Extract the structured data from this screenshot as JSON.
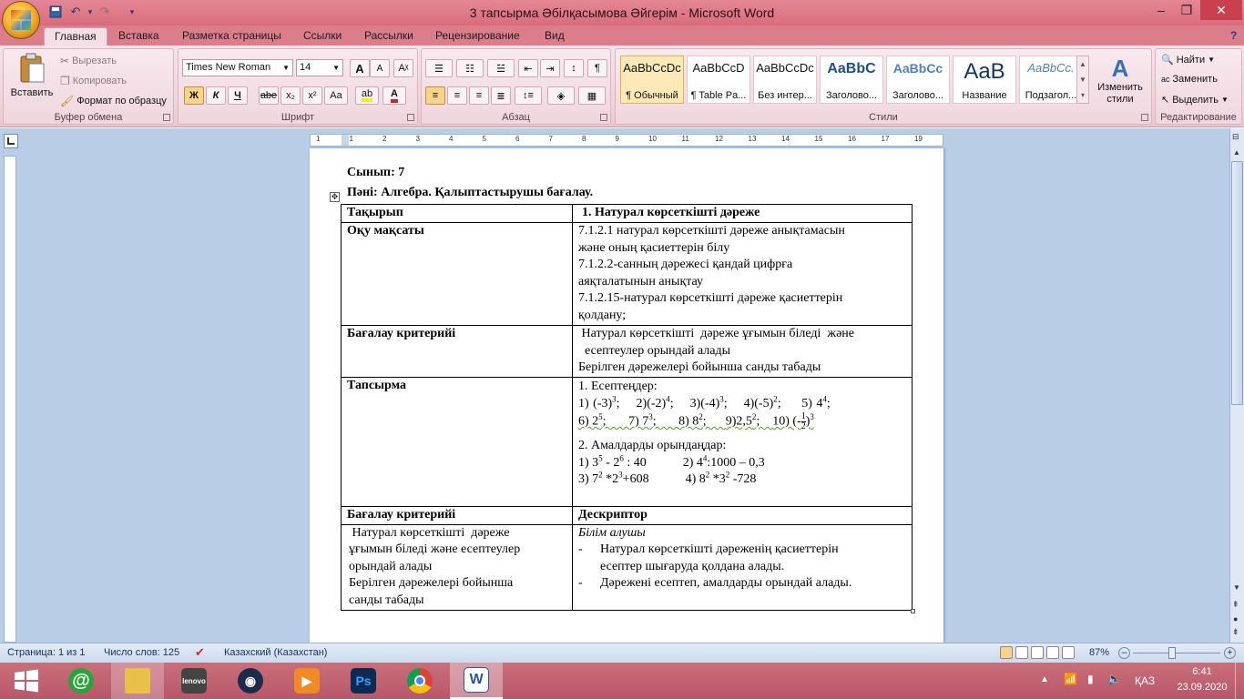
{
  "window": {
    "title": "3 тапсырма Әбілқасымова Әйгерім - Microsoft Word"
  },
  "qat": {
    "undo": "↶",
    "redo": "↷"
  },
  "tabs": [
    "Главная",
    "Вставка",
    "Разметка страницы",
    "Ссылки",
    "Рассылки",
    "Рецензирование",
    "Вид"
  ],
  "clipboard": {
    "paste": "Вставить",
    "cut": "Вырезать",
    "copy": "Копировать",
    "format_painter": "Формат по образцу",
    "label": "Буфер обмена"
  },
  "font": {
    "name": "Times New Roman",
    "size": "14",
    "label": "Шрифт",
    "bold": "Ж",
    "italic": "К",
    "underline": "Ч",
    "strike": "abe",
    "sub": "x₂",
    "sup": "x²",
    "case": "Aa",
    "grow": "A",
    "shrink": "A"
  },
  "paragraph": {
    "label": "Абзац"
  },
  "styles": {
    "label": "Стили",
    "items": [
      {
        "preview": "AaBbCcDc",
        "name": "¶ Обычный"
      },
      {
        "preview": "AaBbCcD",
        "name": "¶ Table Pa..."
      },
      {
        "preview": "AaBbCcDc",
        "name": "Без интер..."
      },
      {
        "preview": "AaBbC",
        "name": "Заголово..."
      },
      {
        "preview": "AaBbCc",
        "name": "Заголово..."
      },
      {
        "preview": "AaB",
        "name": "Название"
      },
      {
        "preview": "AaBbCc.",
        "name": "Подзагол..."
      }
    ],
    "change": "Изменить стили"
  },
  "editing": {
    "label": "Редактирование",
    "find": "Найти",
    "replace": "Заменить",
    "select": "Выделить"
  },
  "ruler": {
    "numbers": [
      "1",
      "1",
      "2",
      "3",
      "4",
      "5",
      "6",
      "7",
      "8",
      "9",
      "10",
      "11",
      "12",
      "13",
      "14",
      "15",
      "16",
      "17",
      "19"
    ]
  },
  "document": {
    "line1": "Сынып: 7",
    "line2": "Пәні: Алгебра. Қалыптастырушы бағалау.",
    "r1": {
      "a": "Тақырып",
      "b": "1. Натурал көрсеткішті дәреже"
    },
    "r2": {
      "a": "Оқу мақсаты",
      "b1": "7.1.2.1 натурал көрсеткішті  дәреже анықтамасын",
      "b2": "және оның қасиеттерін  білу",
      "b3": "7.1.2.2-санның дәрежесі қандай цифрға",
      "b4": "аяқталатынын анықтау",
      "b5": "7.1.2.15-натурал көрсеткішті  дәреже қасиеттерін",
      "b6": "қолдану;"
    },
    "r3": {
      "a": "Бағалау критерийі",
      "b1": " Натурал көрсеткішті  дәреже ұғымын біледі  және",
      "b2": "  есептеулер орындай алады",
      "b3": "Берілген дәрежелері  бойынша  санды табады"
    },
    "r4": {
      "a": "Тапсырма",
      "b1": "1. Есептеңдер:",
      "e1": "1) (-3)",
      "e2": "2)(-2)",
      "e3": "3)(-4)",
      "e4": "4)(-5)",
      "e5": "5) 4",
      "e6": "6) 2",
      "e7": "7) 7",
      "e8": "8) 8",
      "e9": "9)2,5",
      "e10": "10) (-",
      "e10b": ")",
      "half_n": "1",
      "half_d": "2",
      "s3": "3",
      "s4": "4",
      "s2": "2",
      "s5": "5",
      "b2": "2. Амалдарды  орындаңдар:",
      "c1": "1) 3",
      "c1b": " - 2",
      "c1c": " : 40",
      "c2": "2) 4",
      "c2b": ":1000 – 0,3",
      "c3": "3) 7",
      "c3b": " *2",
      "c3c": "+608",
      "c4": "4) 8",
      "c4b": " *3",
      "c4c": " -728",
      "s6": "6"
    },
    "r5": {
      "a": "Бағалау критерийі",
      "b": "Дескриптор"
    },
    "r6": {
      "a1": " Натурал көрсеткішті  дәреже",
      "a2": "ұғымын біледі  және есептеулер",
      "a3": "орындай алады",
      "a4": "Берілген дәрежелері  бойынша",
      "a5": "санды табады",
      "b0": "Білім алушы",
      "d1a": "Натурал көрсеткішті  дәреженің қасиеттерін",
      "d1b": "есептер шығаруда қолдана алады.",
      "d2": "Дәрежені есептеп, амалдарды орындай алады.",
      "dash": "-"
    }
  },
  "status": {
    "page": "Страница: 1 из 1",
    "words": "Число слов: 125",
    "lang": "Казахский (Казахстан)",
    "zoom": "87%"
  },
  "taskbar": {
    "lang": "ҚАЗ",
    "time": "6:41",
    "date": "23.09.2020"
  }
}
